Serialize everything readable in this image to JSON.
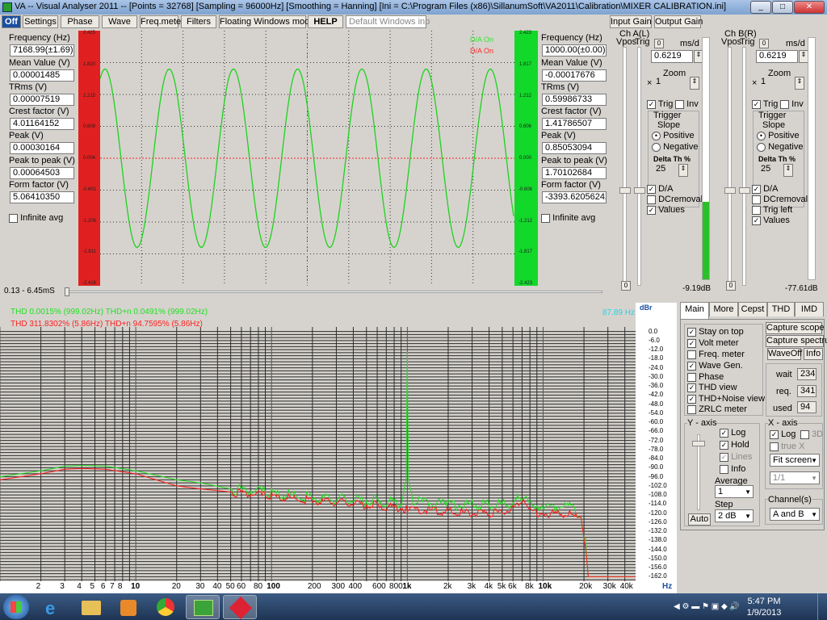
{
  "window": {
    "title": "VA -- Visual Analyser 2011 --  [Points = 32768]  [Sampling = 96000Hz]  [Smoothing = Hanning]  [Ini = C:\\Program Files (x86)\\SillanumSoft\\VA2011\\Calibration\\MIXER CALIBRATION.ini]",
    "min": "_",
    "max": "□",
    "close": "✕"
  },
  "toolbar": {
    "off": "Off",
    "settings": "Settings",
    "phase": "Phase",
    "wave": "Wave",
    "freqmeter": "Freq.meter",
    "filters": "Filters",
    "floating": "Floating Windows mode",
    "help": "HELP",
    "windows_select": "Default Windows inp",
    "input_gain": "Input Gain",
    "output_gain": "Output Gain"
  },
  "left_meter": {
    "frequency_label": "Frequency (Hz)",
    "frequency": "7168.99(±1.69)",
    "mean_label": "Mean Value (V)",
    "mean": "0.00001485",
    "trms_label": "TRms (V)",
    "trms": "0.00007519",
    "crest_label": "Crest factor (V)",
    "crest": "4.01164152",
    "peak_label": "Peak (V)",
    "peak": "0.00030164",
    "p2p_label": "Peak to peak (V)",
    "p2p": "0.00064503",
    "form_label": "Form factor (V)",
    "form": "5.06410350",
    "infinite_avg": "Infinite avg"
  },
  "right_meter": {
    "frequency_label": "Frequency (Hz)",
    "frequency": "1000.00(±0.00)",
    "mean_label": "Mean Value (V)",
    "mean": "-0.00017676",
    "trms_label": "TRms (V)",
    "trms": "0.59986733",
    "crest_label": "Crest factor (V)",
    "crest": "1.41786507",
    "peak_label": "Peak (V)",
    "peak": "0.85053094",
    "p2p_label": "Peak to peak (V)",
    "p2p": "1.70102684",
    "form_label": "Form factor (V)",
    "form": "-3393.62056242",
    "infinite_avg": "Infinite avg"
  },
  "scope": {
    "legend_a": "D/A On",
    "legend_b": "D/A On",
    "left_ticks": [
      "2.425",
      "1.820",
      "1.215",
      "0.609",
      "0.004",
      "-0.601",
      "-1.206",
      "-1.811",
      "-2.416"
    ],
    "right_ticks": [
      "2.423",
      "1.817",
      "1.212",
      "0.606",
      "0.000",
      "-0.606",
      "-1.212",
      "-1.817",
      "-2.423"
    ],
    "time_range": "0.13 - 6.45mS",
    "cycles": 6.45,
    "amplitude_fraction": 0.35,
    "color_a": "#1fd11f",
    "color_b": "#ff2020"
  },
  "chA": {
    "title": "Ch A(L)",
    "vpos": "Vpos",
    "trig_label": "Trig",
    "msd": "ms/d",
    "msd_value": "0.6219",
    "zoom": "Zoom",
    "zoom_value": "1",
    "zoom_prefix": "×",
    "trig": "Trig",
    "inv": "Inv",
    "trigger": "Trigger",
    "slope": "Slope",
    "positive": "Positive",
    "negative": "Negative",
    "delta_th": "Delta Th %",
    "delta_value": "25",
    "da": "D/A",
    "dcremoval": "DCremoval",
    "values": "Values",
    "zero_btn": "0",
    "level_db": "-9.19dB",
    "level_fraction": 0.32
  },
  "chB": {
    "title": "Ch B(R)",
    "vpos": "Vpos",
    "trig_label": "Trig",
    "msd": "ms/d",
    "msd_value": "0.6219",
    "zoom": "Zoom",
    "zoom_value": "1",
    "zoom_prefix": "×",
    "trig": "Trig",
    "inv": "Inv",
    "trigger": "Trigger",
    "slope": "Slope",
    "positive": "Positive",
    "negative": "Negative",
    "delta_th": "Delta Th %",
    "delta_value": "25",
    "da": "D/A",
    "dcremoval": "DCremoval",
    "trig_left": "Trig left",
    "values": "Values",
    "zero_btn": "0",
    "level_db": "-77.61dB",
    "level_fraction": 0.0
  },
  "spectrum": {
    "thd_a": "THD 0.0015% (999.02Hz) THD+n 0.0491% (999.02Hz)",
    "thd_b": "THD 311.8302% (5.86Hz) THD+n 94.7595% (5.86Hz)",
    "marker_freq": "87.89 Hz",
    "y_unit": "dBr",
    "y_ticks": [
      "0.0",
      "-6.0",
      "-12.0",
      "-18.0",
      "-24.0",
      "-30.0",
      "-36.0",
      "-42.0",
      "-48.0",
      "-54.0",
      "-60.0",
      "-66.0",
      "-72.0",
      "-78.0",
      "-84.0",
      "-90.0",
      "-96.0",
      "-102.0",
      "-108.0",
      "-114.0",
      "-120.0",
      "-126.0",
      "-132.0",
      "-138.0",
      "-144.0",
      "-150.0",
      "-156.0",
      "-162.0"
    ],
    "x_ticks": [
      {
        "f": 2,
        "label": "2"
      },
      {
        "f": 3,
        "label": "3"
      },
      {
        "f": 4,
        "label": "4"
      },
      {
        "f": 5,
        "label": "5"
      },
      {
        "f": 6,
        "label": "6"
      },
      {
        "f": 7,
        "label": "7"
      },
      {
        "f": 8,
        "label": "8"
      },
      {
        "f": 10,
        "label": "10",
        "bold": true
      },
      {
        "f": 20,
        "label": "20"
      },
      {
        "f": 30,
        "label": "30"
      },
      {
        "f": 40,
        "label": "40"
      },
      {
        "f": 50,
        "label": "50"
      },
      {
        "f": 60,
        "label": "60"
      },
      {
        "f": 80,
        "label": "80"
      },
      {
        "f": 100,
        "label": "100",
        "bold": true
      },
      {
        "f": 200,
        "label": "200"
      },
      {
        "f": 300,
        "label": "300"
      },
      {
        "f": 400,
        "label": "400"
      },
      {
        "f": 600,
        "label": "600"
      },
      {
        "f": 800,
        "label": "800"
      },
      {
        "f": 1000,
        "label": "1k",
        "bold": true
      },
      {
        "f": 2000,
        "label": "2k"
      },
      {
        "f": 3000,
        "label": "3k"
      },
      {
        "f": 4000,
        "label": "4k"
      },
      {
        "f": 5000,
        "label": "5k"
      },
      {
        "f": 6000,
        "label": "6k"
      },
      {
        "f": 8000,
        "label": "8k"
      },
      {
        "f": 10000,
        "label": "10k",
        "bold": true
      },
      {
        "f": 20000,
        "label": "20k"
      },
      {
        "f": 30000,
        "label": "30k"
      },
      {
        "f": 40000,
        "label": "40k"
      }
    ],
    "x_unit": "Hz",
    "f_min": 1,
    "f_max": 48000,
    "db_min": -165,
    "db_max": 3,
    "color_a": "#22e022",
    "color_b": "#ff1a1a",
    "trace_a": [
      [
        1,
        -96
      ],
      [
        2,
        -92
      ],
      [
        3,
        -89
      ],
      [
        4,
        -88.5
      ],
      [
        6,
        -89
      ],
      [
        10,
        -92
      ],
      [
        20,
        -98
      ],
      [
        30,
        -100
      ],
      [
        50,
        -104
      ],
      [
        100,
        -107
      ],
      [
        200,
        -110
      ],
      [
        300,
        -111
      ],
      [
        600,
        -112
      ],
      [
        900,
        -113
      ],
      [
        980,
        -100
      ],
      [
        1000,
        -12
      ],
      [
        1020,
        -100
      ],
      [
        1100,
        -113
      ],
      [
        2000,
        -114
      ],
      [
        4000,
        -115
      ],
      [
        6000,
        -114
      ],
      [
        6500,
        -110
      ],
      [
        7168,
        -108
      ],
      [
        8000,
        -114
      ],
      [
        10000,
        -115
      ],
      [
        16000,
        -116
      ],
      [
        19000,
        -120
      ],
      [
        20500,
        -140
      ],
      [
        21500,
        -162
      ],
      [
        48000,
        -162
      ]
    ],
    "trace_b": [
      [
        1,
        -98
      ],
      [
        2,
        -94
      ],
      [
        3,
        -91
      ],
      [
        4,
        -90.5
      ],
      [
        6,
        -91
      ],
      [
        10,
        -94
      ],
      [
        20,
        -102
      ],
      [
        30,
        -104
      ],
      [
        50,
        -106
      ],
      [
        100,
        -109
      ],
      [
        200,
        -112
      ],
      [
        300,
        -113
      ],
      [
        600,
        -115
      ],
      [
        1000,
        -117
      ],
      [
        2000,
        -119
      ],
      [
        4000,
        -120
      ],
      [
        6000,
        -118
      ],
      [
        7168,
        -110
      ],
      [
        8000,
        -119
      ],
      [
        10000,
        -120
      ],
      [
        16000,
        -121
      ],
      [
        19000,
        -124
      ],
      [
        20500,
        -140
      ],
      [
        21500,
        -162
      ],
      [
        48000,
        -162
      ]
    ]
  },
  "right_tabs": [
    "Main",
    "More",
    "Cepst",
    "THD",
    "IMD"
  ],
  "main_panel": {
    "stay_on_top": "Stay on top",
    "volt_meter": "Volt meter",
    "freq_meter": "Freq. meter",
    "wave_gen": "Wave Gen.",
    "phase": "Phase",
    "thd_view": "THD view",
    "thd_noise": "THD+Noise view",
    "zrlc": "ZRLC meter",
    "capture_scope": "Capture scope",
    "capture_spectrum": "Capture spectrum",
    "waveoff": "WaveOff",
    "info": "Info",
    "wait_label": "wait",
    "wait": "234",
    "req_label": "req.",
    "req": "341",
    "used_label": "used",
    "used": "94",
    "y_axis": "Y - axis",
    "log": "Log",
    "hold": "Hold",
    "lines": "Lines",
    "info2": "Info",
    "average": "Average",
    "average_value": "1",
    "step": "Step",
    "step_value": "2 dB",
    "auto": "Auto",
    "x_axis": "X - axis",
    "xlog": "Log",
    "x3d": "3D",
    "truex": "true X",
    "fit": "Fit screen",
    "ratio": "1/1",
    "channels": "Channel(s)",
    "channels_value": "A and B"
  },
  "taskbar": {
    "time": "5:47 PM",
    "date": "1/9/2013"
  }
}
